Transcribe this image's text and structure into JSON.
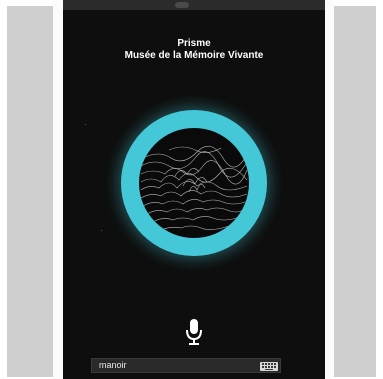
{
  "header": {
    "title_line1": "Prisme",
    "title_line2": "Musée de la Mémoire Vivante"
  },
  "visualizer": {
    "ring_color": "#44c8d8",
    "inner_icon": "wireframe-terrain-icon"
  },
  "voice": {
    "mic_icon": "microphone-icon"
  },
  "input": {
    "value": "manoir",
    "keyboard_icon": "keyboard-icon"
  },
  "colors": {
    "screen_background": "#0e0e0e",
    "side_panels": "#cfcfcf"
  }
}
